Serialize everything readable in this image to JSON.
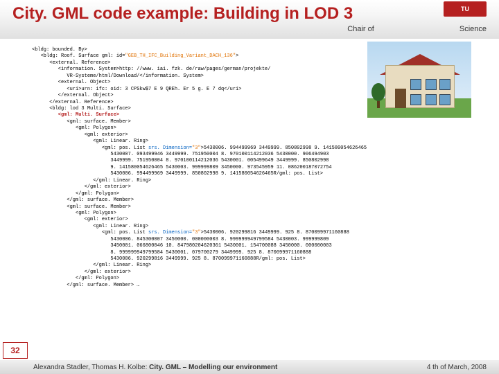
{
  "header": {
    "title": "City. GML code example: Building in LOD 3",
    "subtitle_left": "Chair of",
    "subtitle_right": "Science",
    "logo_label": "TU"
  },
  "slide_number": "32",
  "footer": {
    "left_authors": "Alexandra Stadler, Thomas H. Kolbe: ",
    "left_title_bold": "City. GML – Modelling our environment",
    "right": "4 th of March, 2008"
  },
  "code": {
    "l01": "<bldg: bounded. By>",
    "l02": "   <bldg: Roof. Surface gml: id=",
    "l02a": "\"GEB_TH_IFC_Building_Variant_DACH_136\"",
    "l02b": ">",
    "l03": "      <external. Reference>",
    "l04": "         <information. System>http: //www. iai. fzk. de/raw/pages/german/projekte/",
    "l05": "            VR-Systeme/html/Download/</information. System>",
    "l06": "         <external. Object>",
    "l07": "            <uri>urn: ifc: oid: 3 CPSkw$7 E 9 QREh. Er 5 g. E 7 dq</uri>",
    "l08": "         </external. Object>",
    "l09": "      </external. Reference>",
    "l10": "      <bldg: lod 3 Multi. Surface>",
    "l11": "         <gml: Multi. Surface>",
    "l12": "            <gml: surface. Member>",
    "l13": "               <gml: Polygon>",
    "l14": "                  <gml: exterior>",
    "l15": "                     <gml: Linear. Ring>",
    "l16": "                        <gml: pos. List ",
    "l16a": "srs. Dimension=",
    "l16b": "\"3\"",
    "l16c": ">5430006. 994499969 3449999. 850802998 9. 141580054626465",
    "l17": "                           5430007. 093499946 3449999. 751950004 8. 970100114212036 5430000. 906494903",
    "l18": "                           3449999. 751950004 8. 970100114212036 5430001. 005499649 3449999. 850802998",
    "l19": "                           9. 141580054626465 5430003. 999999809 3450000. 973545959 11. 086200187072754",
    "l20": "                           5430006. 994499969 3449999. 850802998 9. 141580054626465R/gml: pos. List>",
    "l21": "                     </gml: Linear. Ring>",
    "l22": "                  </gml: exterior>",
    "l23": "               </gml: Polygon>",
    "l24": "            </gml: surface. Member>",
    "l25": "            <gml: surface. Member>",
    "l26": "               <gml: Polygon>",
    "l27": "                  <gml: exterior>",
    "l28": "                     <gml: Linear. Ring>",
    "l29": "                        <gml: pos. List ",
    "l29a": "srs. Dimension=",
    "l29b": "\"3\"",
    "l29c": ">5430006. 920299816 3449999. 925 8. 870099971160888",
    "l30": "                           5430006. 845300007 3450000. 000000003 8. 999999949799584 5430003. 999999809",
    "l31": "                           3450001. 066800046 10. 847980204620361 5430001. 154700088 3450000. 000000003",
    "l32": "                           8. 999999949799584 5430001. 079700279 3449999. 925 8. 870099971160888",
    "l33": "                           5430006. 920299816 3449999. 925 8. 870099971160888R/gml: pos. List>",
    "l34": "                     </gml: Linear. Ring>",
    "l35": "                  </gml: exterior>",
    "l36": "               </gml: Polygon>",
    "l37": "            </gml: surface. Member> …"
  }
}
